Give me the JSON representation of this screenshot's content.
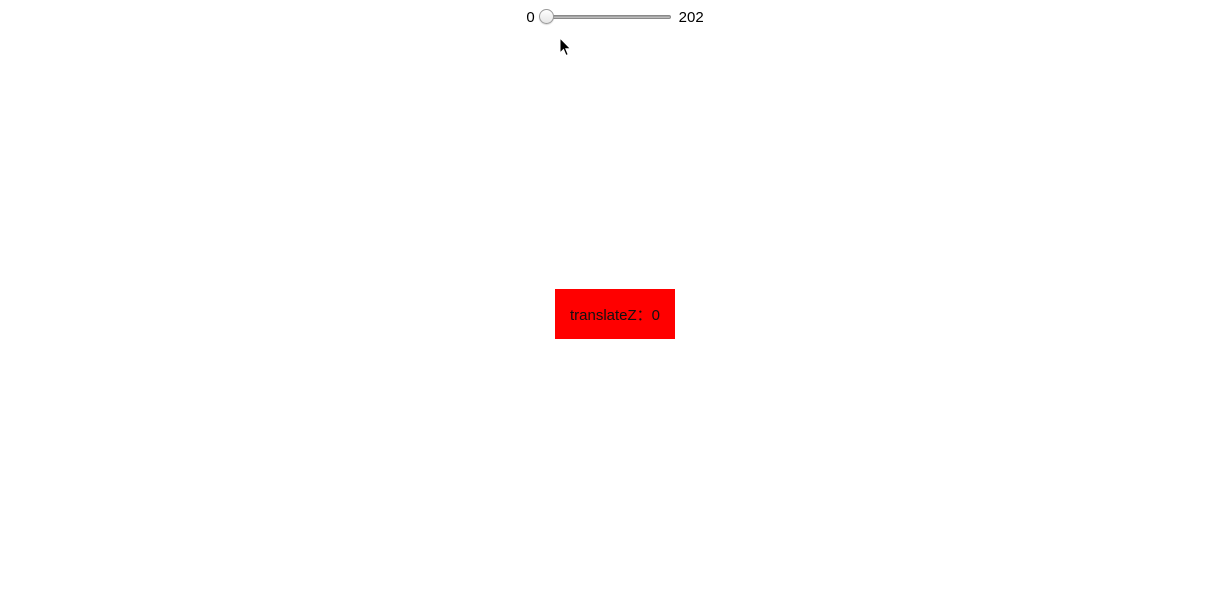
{
  "slider": {
    "min_label": "0",
    "max_label": "202",
    "min": 0,
    "max": 202,
    "value": 0
  },
  "box": {
    "text": "translateZ：0",
    "color": "#ff0000"
  },
  "cursor": {
    "icon": "arrow-cursor-icon"
  }
}
